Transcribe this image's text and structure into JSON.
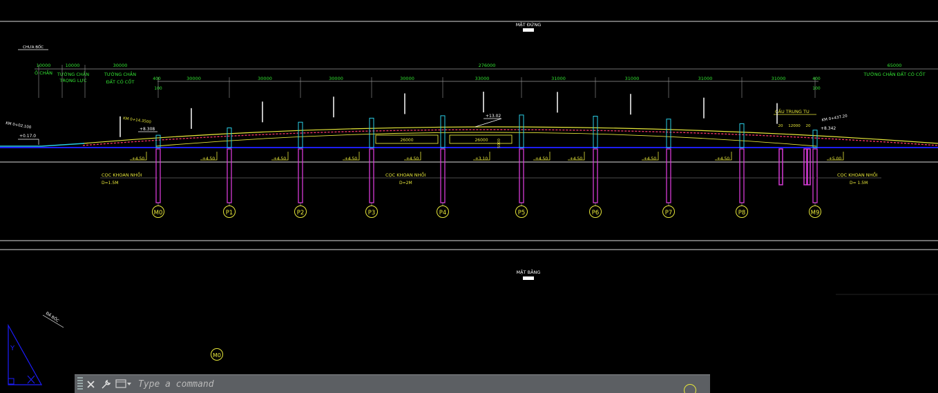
{
  "drawing": {
    "elevation_title": "MẶT ĐỨNG",
    "plan_title": "MẶT BẰNG",
    "chua_boc": "CHƯA BỐC",
    "phan_boc": "ĐÃ BỐC",
    "total_span": "276000",
    "right_span": "65000",
    "right_wall_label": "TƯỜNG CHẮN ĐẤT CÓ CỐT",
    "left_dims": [
      "10000",
      "10000",
      "30000"
    ],
    "left_labels": [
      "Ô CHẮN",
      "TƯỜNG CHẮN",
      "TRỌNG LỰC",
      "TƯỜNG CHẮN",
      "ĐẤT CÓ CỐT"
    ],
    "edge_dims": [
      "400",
      "100",
      "400",
      "100"
    ],
    "span_dims": [
      "30000",
      "30000",
      "30000",
      "30000",
      "33000",
      "31000",
      "31000",
      "31000",
      "31000"
    ],
    "km_left": "KM 0+14.3500",
    "km_far_left": "KM 0+02.100",
    "km_right": "KM 0+437.20",
    "elev_left": "+8.308",
    "elev_far_left": "+0.17.0",
    "elev_top": "+13.02",
    "elev_right": "+8.342",
    "cau_trung_tu": "CẦU TRUNG TU",
    "right_small_dims": [
      "20",
      "12000",
      "20"
    ],
    "clearance": [
      "26000",
      "26000"
    ],
    "vert_dim": "5000",
    "water_levels": [
      "+4.50",
      "+4.50",
      "+4.50",
      "+4.50",
      "+4.50",
      "+3.10",
      "+4.50",
      "+4.50",
      "+4.50",
      "+4.50",
      "+5.00"
    ],
    "pile_labels": [
      {
        "title": "CỌC KHOAN NHỒI",
        "dia": "D=1.5M"
      },
      {
        "title": "CỌC KHOAN NHỒI",
        "dia": "D=2M"
      },
      {
        "title": "CỌC KHOAN NHỒI",
        "dia": "D= 1.5M"
      }
    ],
    "piers": [
      "M0",
      "P1",
      "P2",
      "P3",
      "P4",
      "P5",
      "P6",
      "P7",
      "P8",
      "M9"
    ],
    "plan_marker": "M0",
    "ucs_label": "Y"
  },
  "command_line": {
    "placeholder": "Type a command",
    "value": ""
  },
  "colors": {
    "dim": "#33e633",
    "text_yellow": "#e8e83a",
    "pile": "#d63bd6",
    "deck": "#3b3bff",
    "white": "#ffffff",
    "cyan": "#2ad0e8",
    "blue": "#1d1dff"
  }
}
